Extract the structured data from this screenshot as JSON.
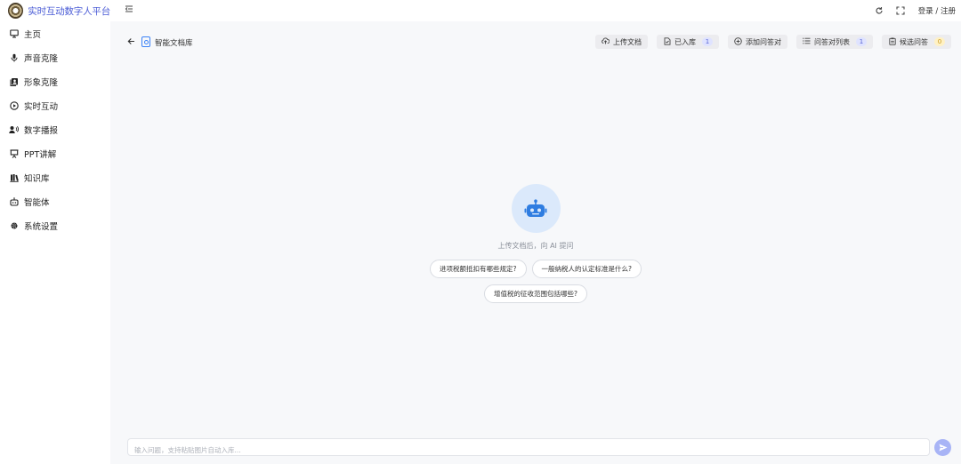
{
  "header": {
    "app_title": "实时互动数字人平台",
    "login_label": "登录 / 注册"
  },
  "sidebar": {
    "items": [
      {
        "label": "主页",
        "icon": "monitor-icon"
      },
      {
        "label": "声音克隆",
        "icon": "microphone-icon"
      },
      {
        "label": "形象克隆",
        "icon": "portrait-icon"
      },
      {
        "label": "实时互动",
        "icon": "play-circle-icon"
      },
      {
        "label": "数字播报",
        "icon": "speaker-user-icon"
      },
      {
        "label": "PPT讲解",
        "icon": "presentation-icon"
      },
      {
        "label": "知识库",
        "icon": "books-icon"
      },
      {
        "label": "智能体",
        "icon": "robot-icon"
      },
      {
        "label": "系统设置",
        "icon": "gear-icon"
      }
    ]
  },
  "main": {
    "title": "智能文档库",
    "actions": [
      {
        "label": "上传文档",
        "icon": "cloud-upload-icon"
      },
      {
        "label": "已入库",
        "icon": "file-check-icon",
        "badge": "1"
      },
      {
        "label": "添加问答对",
        "icon": "plus-circle-icon"
      },
      {
        "label": "问答对列表",
        "icon": "list-icon",
        "badge": "1"
      },
      {
        "label": "候选问答",
        "icon": "clipboard-icon",
        "badge": "0"
      }
    ],
    "hint": "上传文档后，向 AI 提问",
    "suggestions": [
      "进项税额抵扣有哪些规定?",
      "一般纳税人的认定标准是什么?",
      "增值税的征收范围包括哪些?"
    ],
    "input_placeholder": "输入问题，支持粘贴图片自动入库..."
  },
  "colors": {
    "brand": "#4b5cd6",
    "accent_blue": "#3b82f6",
    "send_button": "#a8b4f6",
    "badge_yellow": "#fff1c4"
  }
}
